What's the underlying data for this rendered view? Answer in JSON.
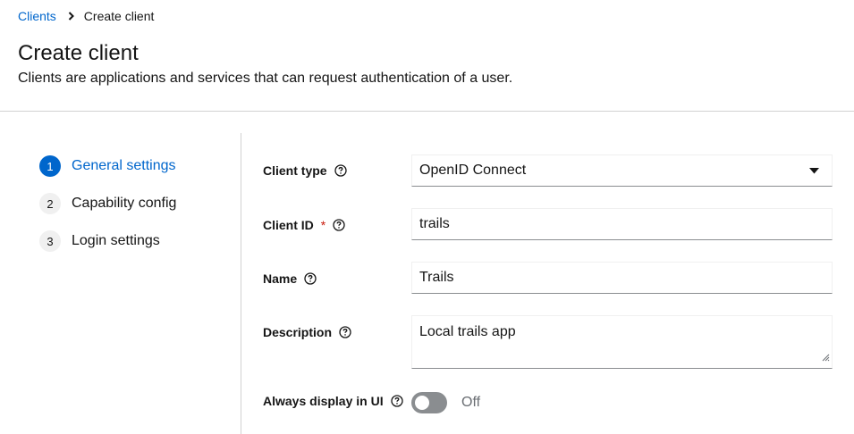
{
  "breadcrumb": {
    "parent": "Clients",
    "current": "Create client"
  },
  "header": {
    "title": "Create client",
    "subtitle": "Clients are applications and services that can request authentication of a user."
  },
  "wizard": {
    "steps": [
      {
        "number": "1",
        "label": "General settings",
        "active": true
      },
      {
        "number": "2",
        "label": "Capability config",
        "active": false
      },
      {
        "number": "3",
        "label": "Login settings",
        "active": false
      }
    ]
  },
  "form": {
    "client_type": {
      "label": "Client type",
      "value": "OpenID Connect"
    },
    "client_id": {
      "label": "Client ID",
      "required_mark": "*",
      "value": "trails"
    },
    "name": {
      "label": "Name",
      "value": "Trails"
    },
    "description": {
      "label": "Description",
      "value": "Local trails app"
    },
    "always_display": {
      "label": "Always display in UI",
      "state": "Off"
    }
  },
  "colors": {
    "accent": "#0066cc",
    "required": "#c9190b",
    "switch_off": "#8a8d90"
  },
  "icons": {
    "help": "question-circle-icon",
    "caret": "caret-down-icon",
    "separator": "angle-right-icon"
  }
}
